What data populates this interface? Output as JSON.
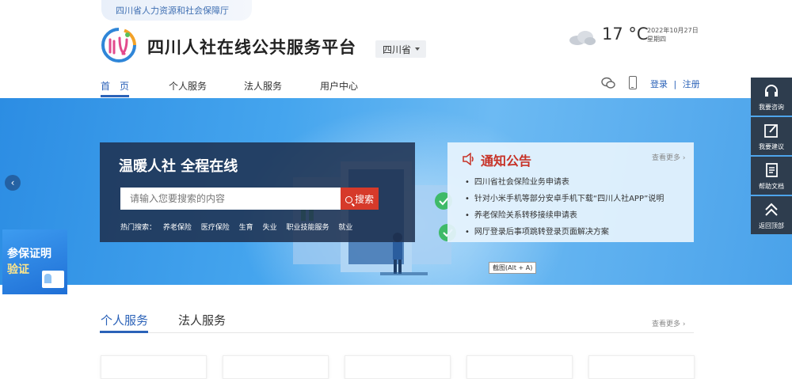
{
  "header": {
    "ministry": "四川省人力资源和社会保障厅",
    "title": "四川人社在线公共服务平台",
    "region": "四川省",
    "weather": {
      "temp": "17 °C",
      "date": "2022年10月27日",
      "weekday": "星期四",
      "icon": "cloud-icon"
    }
  },
  "nav": {
    "items": [
      "首　页",
      "个人服务",
      "法人服务",
      "用户中心"
    ],
    "active_index": 0,
    "login": "登录",
    "divider": "|",
    "register": "注册"
  },
  "banner": {
    "slogan": "温暖人社 全程在线",
    "search_placeholder": "请输入您要搜索的内容",
    "search_button": "搜索",
    "hot_label": "热门搜索：",
    "hot_terms": [
      "养老保险",
      "医疗保险",
      "生育",
      "失业",
      "职业技能服务",
      "就业"
    ]
  },
  "notice": {
    "title": "通知公告",
    "more": "查看更多",
    "items": [
      "四川省社会保险业务申请表",
      "针对小米手机等部分安卓手机下载“四川人社APP”说明",
      "养老保险关系转移接续申请表",
      "网厅登录后事项跳转登录页面解决方案"
    ]
  },
  "screenshot_tip": "截图(Alt + A)",
  "cert_badge": {
    "line1": "参保证明",
    "line2": "验证"
  },
  "sidebar": [
    {
      "label": "我要咨询",
      "icon": "headset-icon"
    },
    {
      "label": "我要建议",
      "icon": "edit-icon"
    },
    {
      "label": "帮助文档",
      "icon": "document-icon"
    },
    {
      "label": "返回顶部",
      "icon": "double-chevron-up-icon"
    }
  ],
  "services": {
    "tabs": [
      "个人服务",
      "法人服务"
    ],
    "active_index": 0,
    "more": "查看更多"
  },
  "colors": {
    "brand_blue": "#2b62b8",
    "search_red": "#d63a2a",
    "notice_red": "#c73227",
    "sidebar_dark": "#2e3d4e"
  }
}
